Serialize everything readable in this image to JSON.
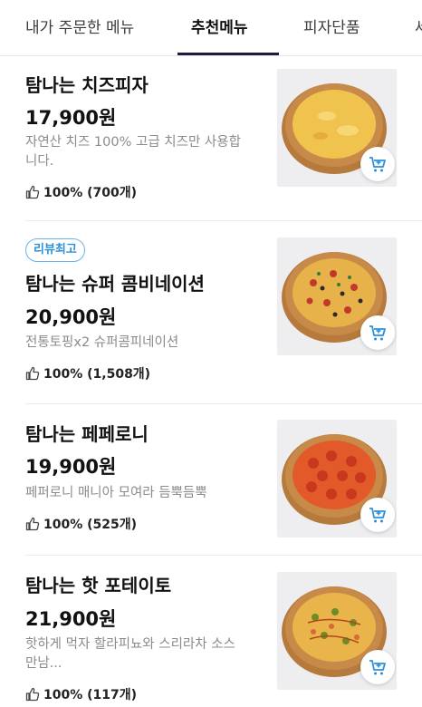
{
  "tabs": [
    {
      "label": "내가 주문한 메뉴"
    },
    {
      "label": "추천메뉴"
    },
    {
      "label": "피자단품"
    },
    {
      "label": "세"
    }
  ],
  "menu": [
    {
      "name": "탐나는 치즈피자",
      "price": "17,900원",
      "desc": "자연산 치즈 100% 고급 치즈만 사용합니다.",
      "rating": "100% (700개)",
      "badge": ""
    },
    {
      "name": "탐나는 슈퍼 콤비네이션",
      "price": "20,900원",
      "desc": "전통토핑x2 슈퍼콤피네이션",
      "rating": "100% (1,508개)",
      "badge": "리뷰최고"
    },
    {
      "name": "탐나는 페페로니",
      "price": "19,900원",
      "desc": "페퍼로니 매니아 모여라 듬뿍듬뿍",
      "rating": "100% (525개)",
      "badge": ""
    },
    {
      "name": "탐나는 핫 포테이토",
      "price": "21,900원",
      "desc": "핫하게 먹자 할라피뇨와 스리라차 소스 만남...",
      "rating": "100% (117개)",
      "badge": ""
    }
  ],
  "colors": {
    "accent_blue": "#2d8fd9",
    "tab_underline": "#1f1b3d"
  },
  "icons": {
    "rating": "thumbs-up-icon",
    "cart": "cart-add-icon"
  }
}
